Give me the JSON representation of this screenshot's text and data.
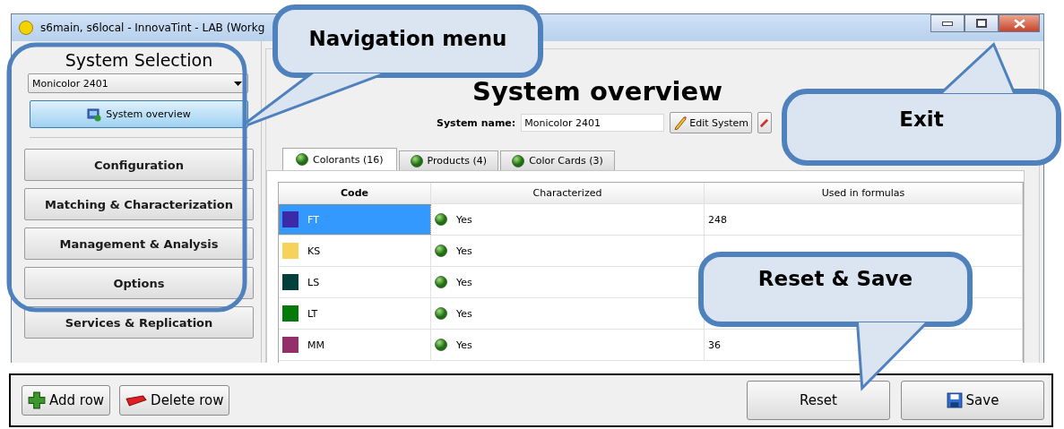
{
  "window": {
    "title": "s6main, s6local - InnovaTint - LAB (Workg"
  },
  "sidebar": {
    "heading": "System Selection",
    "system_select": {
      "value": "Monicolor 2401"
    },
    "overview_button": {
      "label": "System overview",
      "selected": true
    },
    "nav_items": [
      {
        "label": "Configuration"
      },
      {
        "label": "Matching & Characterization"
      },
      {
        "label": "Management & Analysis"
      },
      {
        "label": "Options"
      },
      {
        "label": "Services & Replication"
      }
    ]
  },
  "main": {
    "heading": "System overview",
    "system_name": {
      "label": "System name:",
      "value": "Monicolor 2401"
    },
    "edit_button": "Edit System",
    "tabs": [
      {
        "label": "Colorants (16)",
        "selected": true
      },
      {
        "label": "Products (4)",
        "selected": false
      },
      {
        "label": "Color Cards (3)",
        "selected": false
      }
    ],
    "table": {
      "columns": [
        "Code",
        "Characterized",
        "Used in formulas"
      ],
      "rows": [
        {
          "code": "FT",
          "color": "#3d2aa8",
          "characterized": "Yes",
          "used_in_formulas": "248",
          "selected": true
        },
        {
          "code": "KS",
          "color": "#f7d25a",
          "characterized": "Yes",
          "selected": false
        },
        {
          "code": "LS",
          "color": "#033f3c",
          "characterized": "Yes",
          "selected": false
        },
        {
          "code": "LT",
          "color": "#037a0b",
          "characterized": "Yes",
          "selected": false
        },
        {
          "code": "MM",
          "color": "#93306a",
          "characterized": "Yes",
          "used_in_formulas": "36",
          "selected": false
        }
      ]
    }
  },
  "bottom_bar": {
    "buttons": [
      {
        "label": "Add row",
        "kind": "add"
      },
      {
        "label": "Delete row",
        "kind": "delete"
      },
      {
        "label": "Reset",
        "kind": "plain"
      },
      {
        "label": "Save",
        "kind": "save"
      }
    ]
  },
  "callouts": [
    {
      "kind": "highlight"
    },
    {
      "kind": "bubble",
      "text": "Navigation menu"
    },
    {
      "kind": "bubble",
      "text": "Exit"
    },
    {
      "kind": "bubble",
      "text": "Reset & Save"
    }
  ]
}
